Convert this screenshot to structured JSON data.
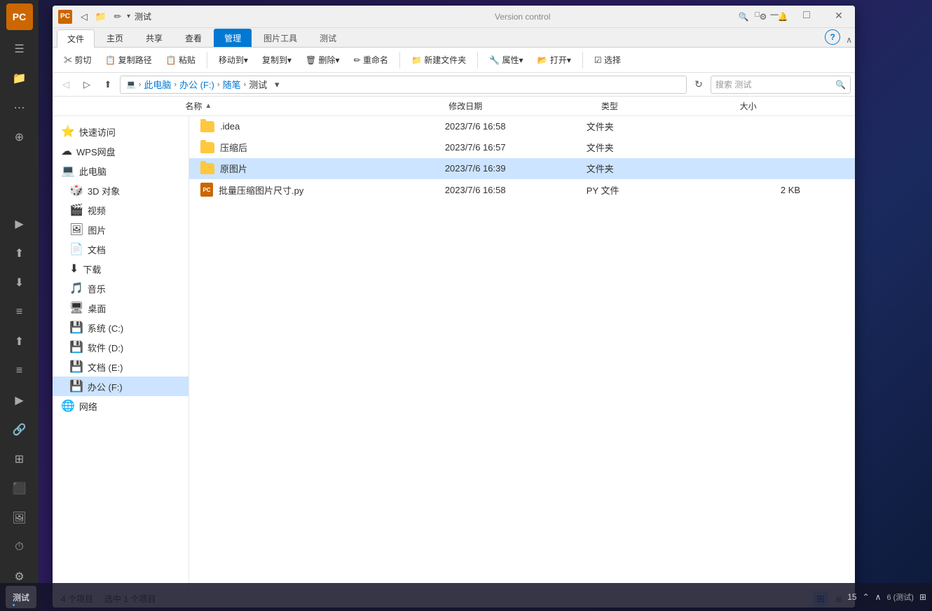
{
  "window": {
    "title": "测试",
    "subtitle": "Version control"
  },
  "title_bar": {
    "icon_text": "PC",
    "title": "测试",
    "minimize": "─",
    "maximize": "□",
    "close": "✕"
  },
  "ribbon": {
    "tabs": [
      {
        "id": "file",
        "label": "文件",
        "active": false,
        "highlighted": false
      },
      {
        "id": "home",
        "label": "主页",
        "active": true,
        "highlighted": false
      },
      {
        "id": "share",
        "label": "共享",
        "active": false,
        "highlighted": false
      },
      {
        "id": "view",
        "label": "查看",
        "active": false,
        "highlighted": false
      },
      {
        "id": "manage",
        "label": "管理",
        "active": false,
        "highlighted": true
      },
      {
        "id": "photo_tools",
        "label": "图片工具",
        "active": false,
        "highlighted": false
      },
      {
        "id": "test_tab",
        "label": "测试",
        "active": false,
        "highlighted": false
      }
    ],
    "toolbar_items": [
      "剪切",
      "复制路径",
      "粘贴",
      "移动到",
      "复制到",
      "删除",
      "重命名",
      "新建文件夹",
      "属性",
      "打开",
      "选择"
    ]
  },
  "address": {
    "path_parts": [
      "此电脑",
      "办公 (F:)",
      "随笔",
      "测试"
    ],
    "search_placeholder": "搜索 测试"
  },
  "columns": {
    "name": "名称",
    "date": "修改日期",
    "type": "类型",
    "size": "大小"
  },
  "nav_tree": [
    {
      "id": "quick_access",
      "label": "快速访问",
      "icon": "⭐",
      "level": 0
    },
    {
      "id": "wps_cloud",
      "label": "WPS网盘",
      "icon": "☁",
      "level": 0
    },
    {
      "id": "this_pc",
      "label": "此电脑",
      "icon": "💻",
      "level": 0
    },
    {
      "id": "3d_objects",
      "label": "3D 对象",
      "icon": "🎲",
      "level": 1
    },
    {
      "id": "videos",
      "label": "视频",
      "icon": "🎬",
      "level": 1
    },
    {
      "id": "pictures",
      "label": "图片",
      "icon": "🖼",
      "level": 1
    },
    {
      "id": "documents",
      "label": "文档",
      "icon": "📄",
      "level": 1
    },
    {
      "id": "downloads",
      "label": "下载",
      "icon": "⬇",
      "level": 1
    },
    {
      "id": "music",
      "label": "音乐",
      "icon": "🎵",
      "level": 1
    },
    {
      "id": "desktop",
      "label": "桌面",
      "icon": "🖥",
      "level": 1
    },
    {
      "id": "system_c",
      "label": "系统 (C:)",
      "icon": "💾",
      "level": 1
    },
    {
      "id": "software_d",
      "label": "软件 (D:)",
      "icon": "💾",
      "level": 1
    },
    {
      "id": "docs_e",
      "label": "文档 (E:)",
      "icon": "💾",
      "level": 1
    },
    {
      "id": "office_f",
      "label": "办公 (F:)",
      "icon": "💾",
      "level": 1,
      "active": true
    },
    {
      "id": "network",
      "label": "网络",
      "icon": "🌐",
      "level": 0
    }
  ],
  "files": [
    {
      "name": ".idea",
      "date": "2023/7/6 16:58",
      "type": "文件夹",
      "size": "",
      "is_folder": true,
      "selected": false
    },
    {
      "name": "压缩后",
      "date": "2023/7/6 16:57",
      "type": "文件夹",
      "size": "",
      "is_folder": true,
      "selected": false
    },
    {
      "name": "原图片",
      "date": "2023/7/6 16:39",
      "type": "文件夹",
      "size": "",
      "is_folder": true,
      "selected": true
    },
    {
      "name": "批量压缩图片尺寸.py",
      "date": "2023/7/6 16:58",
      "type": "PY 文件",
      "size": "2 KB",
      "is_folder": false,
      "selected": false
    }
  ],
  "status": {
    "total": "4 个项目",
    "selected": "选中 1 个项目"
  },
  "taskbar": {
    "items": [
      {
        "label": "测试",
        "active": true
      }
    ],
    "time": "15",
    "right_items": [
      "⌃",
      "∧"
    ]
  },
  "ide_sidebar": {
    "top_icons": [
      "☰",
      "📁",
      "⋯",
      "⊕"
    ],
    "bottom_icons": [
      "▶",
      "⬆",
      "⬇",
      "≡",
      "⬆",
      "≡",
      "⬆",
      "▶",
      "🔧",
      "⬛",
      "🖼",
      "⏱",
      "⚙"
    ]
  }
}
